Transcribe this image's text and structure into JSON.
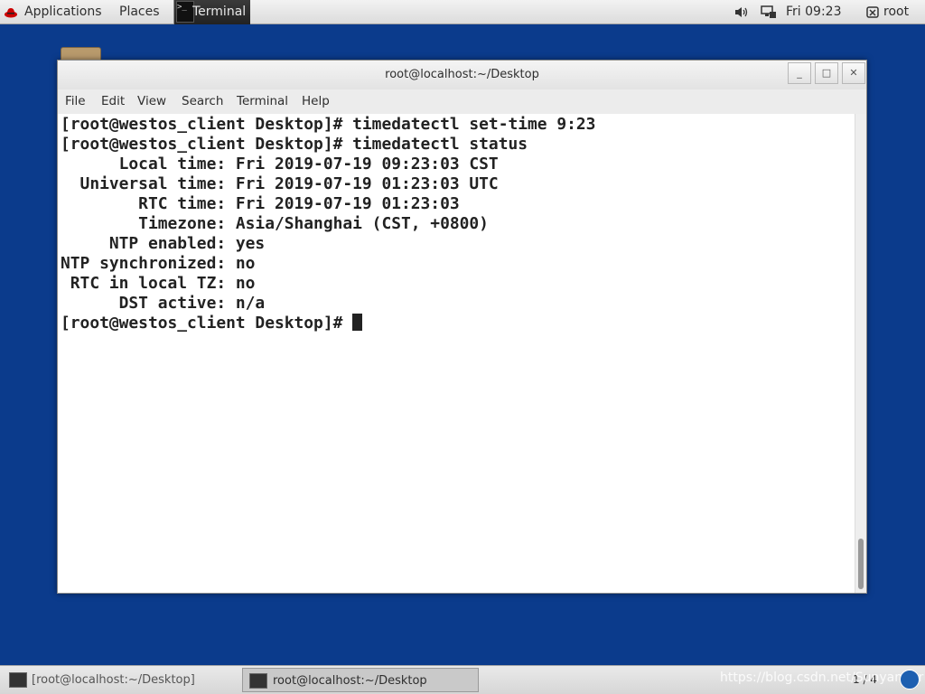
{
  "top_panel": {
    "applications": "Applications",
    "places": "Places",
    "terminal": "Terminal",
    "clock": "Fri 09:23",
    "user": "root"
  },
  "window": {
    "title": "root@localhost:~/Desktop",
    "menu": [
      "File",
      "Edit",
      "View",
      "Search",
      "Terminal",
      "Help"
    ],
    "buttons": {
      "minimize": "_",
      "maximize": "□",
      "close": "✕"
    }
  },
  "terminal_lines": [
    "[root@westos_client Desktop]# timedatectl set-time 9:23",
    "[root@westos_client Desktop]# timedatectl status",
    "      Local time: Fri 2019-07-19 09:23:03 CST",
    "  Universal time: Fri 2019-07-19 01:23:03 UTC",
    "        RTC time: Fri 2019-07-19 01:23:03",
    "        Timezone: Asia/Shanghai (CST, +0800)",
    "     NTP enabled: yes",
    "NTP synchronized: no",
    " RTC in local TZ: no",
    "      DST active: n/a"
  ],
  "prompt": "[root@westos_client Desktop]# ",
  "taskbar": {
    "task1": "[root@localhost:~/Desktop]",
    "task2": "root@localhost:~/Desktop",
    "workspace": "1 / 4",
    "watermark": "https://blog.csdn.net/Sunyanger"
  },
  "icons": {
    "applications": "redhat-icon",
    "volume": "volume-icon",
    "network": "network-icon",
    "user": "user-icon"
  }
}
